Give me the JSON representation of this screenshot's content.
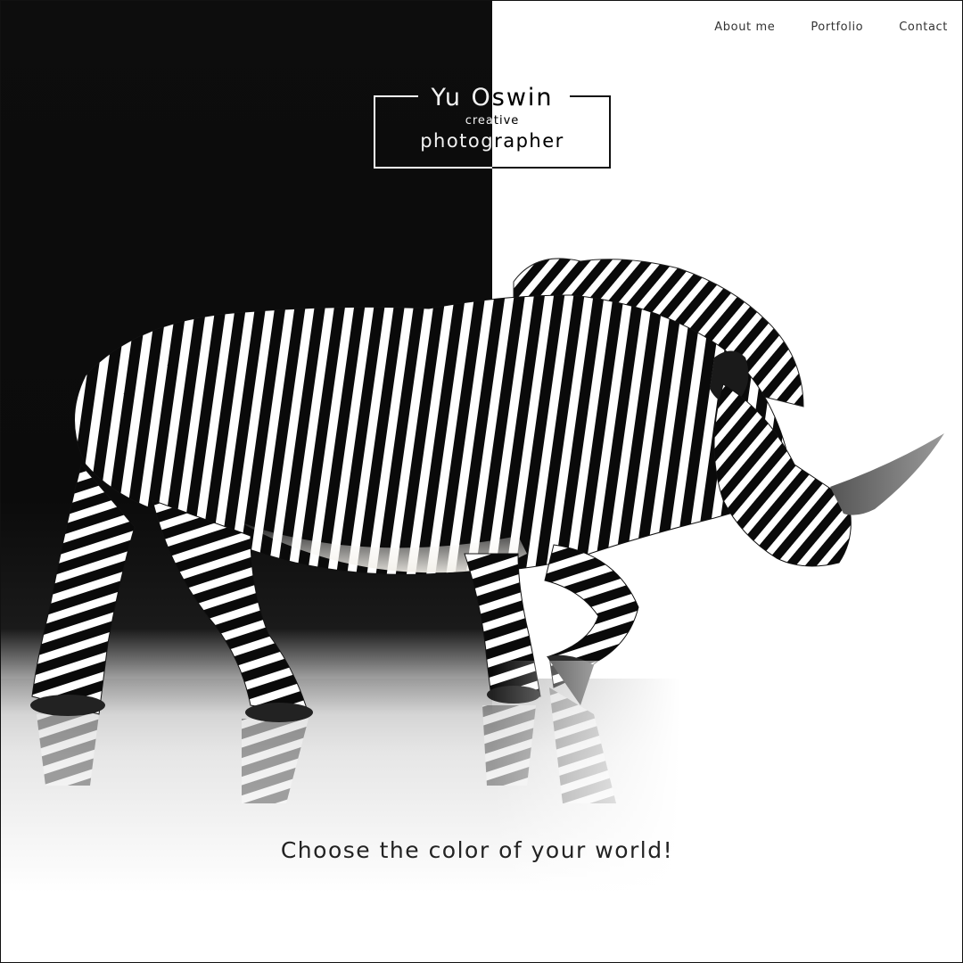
{
  "nav": {
    "items": [
      {
        "label": "About me"
      },
      {
        "label": "Portfolio"
      },
      {
        "label": "Contact"
      }
    ]
  },
  "logo": {
    "name": "Yu Oswin",
    "subtitle": "creative",
    "role": "photographer"
  },
  "hero": {
    "image_subject": "zebra-striped rhino",
    "tagline": "Choose the color of your world!"
  },
  "colors": {
    "dark_panel": "#0d0d0d",
    "light_panel": "#ffffff",
    "text": "#333333"
  }
}
